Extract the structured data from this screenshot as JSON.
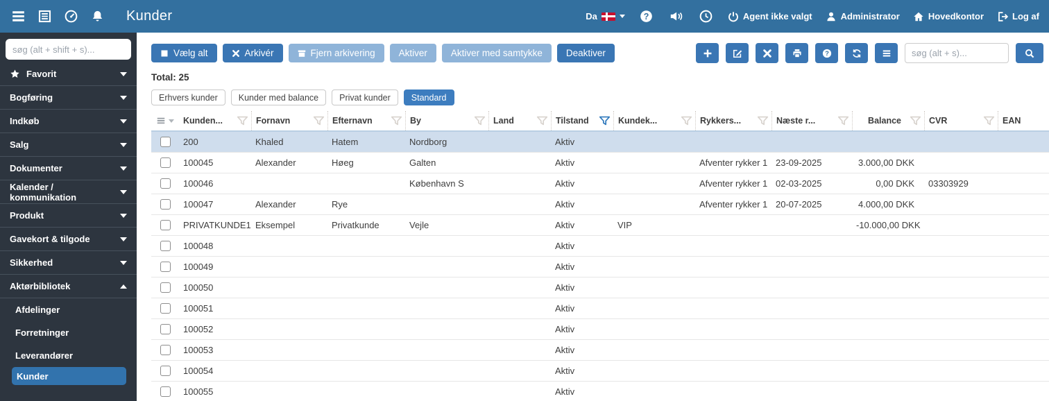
{
  "topbar": {
    "title": "Kunder",
    "left_icons": [
      "menu",
      "journal",
      "dashboard",
      "bell"
    ],
    "language": {
      "code": "Da",
      "flag": "danish-flag"
    },
    "items": [
      {
        "icon": "power",
        "label": "Agent ikke valgt"
      },
      {
        "icon": "user",
        "label": "Administrator"
      },
      {
        "icon": "home",
        "label": "Hovedkontor"
      },
      {
        "icon": "logout",
        "label": "Log af"
      }
    ]
  },
  "sidebar": {
    "search_placeholder": "søg (alt + shift + s)...",
    "items": [
      {
        "label": "Favorit",
        "icon": "star",
        "chevron": "down"
      },
      {
        "label": "Bogføring",
        "chevron": "down"
      },
      {
        "label": "Indkøb",
        "chevron": "down"
      },
      {
        "label": "Salg",
        "chevron": "down"
      },
      {
        "label": "Dokumenter",
        "chevron": "down"
      },
      {
        "label": "Kalender / kommunikation",
        "chevron": "down"
      },
      {
        "label": "Produkt",
        "chevron": "down"
      },
      {
        "label": "Gavekort & tilgode",
        "chevron": "down"
      },
      {
        "label": "Sikkerhed",
        "chevron": "down"
      },
      {
        "label": "Aktørbibliotek",
        "chevron": "up",
        "expanded": true
      }
    ],
    "subitems": [
      {
        "label": "Afdelinger"
      },
      {
        "label": "Forretninger"
      },
      {
        "label": "Leverandører"
      },
      {
        "label": "Kunder",
        "selected": true
      }
    ]
  },
  "toolbar": {
    "buttons": [
      {
        "label": "Vælg alt",
        "icon": "checkbox",
        "variant": "primary"
      },
      {
        "label": "Arkivér",
        "icon": "x",
        "variant": "primary"
      },
      {
        "label": "Fjern arkivering",
        "icon": "archive",
        "variant": "disabled"
      },
      {
        "label": "Aktiver",
        "variant": "disabled"
      },
      {
        "label": "Aktiver med samtykke",
        "variant": "disabled"
      },
      {
        "label": "Deaktiver",
        "variant": "primary"
      }
    ],
    "icon_buttons": [
      "plus",
      "edit",
      "x",
      "print",
      "help",
      "refresh",
      "list"
    ],
    "search_placeholder": "søg (alt + s)..."
  },
  "summary": {
    "total_label": "Total: 25"
  },
  "filters": [
    {
      "label": "Erhvers kunder"
    },
    {
      "label": "Kunder med balance"
    },
    {
      "label": "Privat kunder"
    },
    {
      "label": "Standard",
      "active": true
    }
  ],
  "table": {
    "columns": [
      {
        "key": "kundenummer",
        "label": "Kunden...",
        "filter": true
      },
      {
        "key": "fornavn",
        "label": "Fornavn",
        "filter": true
      },
      {
        "key": "efternavn",
        "label": "Efternavn",
        "filter": true
      },
      {
        "key": "by",
        "label": "By",
        "filter": true
      },
      {
        "key": "land",
        "label": "Land",
        "filter": true
      },
      {
        "key": "tilstand",
        "label": "Tilstand",
        "filter": true,
        "filter_active": true
      },
      {
        "key": "kundekategori",
        "label": "Kundek...",
        "filter": true
      },
      {
        "key": "rykkerstatus",
        "label": "Rykkers...",
        "filter": true
      },
      {
        "key": "naeste_rykker",
        "label": "Næste r...",
        "filter": true
      },
      {
        "key": "balance",
        "label": "Balance",
        "filter": true,
        "align": "right"
      },
      {
        "key": "cvr",
        "label": "CVR",
        "filter": true
      },
      {
        "key": "ean",
        "label": "EAN",
        "filter": false
      }
    ],
    "rows": [
      {
        "selected": true,
        "cells": [
          "200",
          "Khaled",
          "Hatem",
          "Nordborg",
          "",
          "Aktiv",
          "",
          "",
          "",
          "",
          "",
          ""
        ]
      },
      {
        "selected": false,
        "cells": [
          "100045",
          "Alexander",
          "Høeg",
          "Galten",
          "",
          "Aktiv",
          "",
          "Afventer rykker 1",
          "23-09-2025",
          "3.000,00 DKK",
          "",
          ""
        ]
      },
      {
        "selected": false,
        "cells": [
          "100046",
          "",
          "",
          "København S",
          "",
          "Aktiv",
          "",
          "Afventer rykker 1",
          "02-03-2025",
          "0,00 DKK",
          "03303929",
          ""
        ]
      },
      {
        "selected": false,
        "cells": [
          "100047",
          "Alexander",
          "Rye",
          "",
          "",
          "Aktiv",
          "",
          "Afventer rykker 1",
          "20-07-2025",
          "4.000,00 DKK",
          "",
          ""
        ]
      },
      {
        "selected": false,
        "cells": [
          "PRIVATKUNDE1",
          "Eksempel",
          "Privatkunde",
          "Vejle",
          "",
          "Aktiv",
          "VIP",
          "",
          "",
          "-10.000,00 DKK",
          "",
          ""
        ]
      },
      {
        "selected": false,
        "cells": [
          "100048",
          "",
          "",
          "",
          "",
          "Aktiv",
          "",
          "",
          "",
          "",
          "",
          ""
        ]
      },
      {
        "selected": false,
        "cells": [
          "100049",
          "",
          "",
          "",
          "",
          "Aktiv",
          "",
          "",
          "",
          "",
          "",
          ""
        ]
      },
      {
        "selected": false,
        "cells": [
          "100050",
          "",
          "",
          "",
          "",
          "Aktiv",
          "",
          "",
          "",
          "",
          "",
          ""
        ]
      },
      {
        "selected": false,
        "cells": [
          "100051",
          "",
          "",
          "",
          "",
          "Aktiv",
          "",
          "",
          "",
          "",
          "",
          ""
        ]
      },
      {
        "selected": false,
        "cells": [
          "100052",
          "",
          "",
          "",
          "",
          "Aktiv",
          "",
          "",
          "",
          "",
          "",
          ""
        ]
      },
      {
        "selected": false,
        "cells": [
          "100053",
          "",
          "",
          "",
          "",
          "Aktiv",
          "",
          "",
          "",
          "",
          "",
          ""
        ]
      },
      {
        "selected": false,
        "cells": [
          "100054",
          "",
          "",
          "",
          "",
          "Aktiv",
          "",
          "",
          "",
          "",
          "",
          ""
        ]
      },
      {
        "selected": false,
        "cells": [
          "100055",
          "",
          "",
          "",
          "",
          "Aktiv",
          "",
          "",
          "",
          "",
          "",
          ""
        ]
      }
    ]
  },
  "colors": {
    "topbar": "#33709f",
    "sidebar": "#2d353f",
    "primary_button": "#3a76b4",
    "disabled_button": "#8fb4d9",
    "active_chip": "#3d7dbf",
    "selected_nav_item": "#3273ad",
    "selected_row": "#cfdded",
    "active_filter": "#2e78bc"
  }
}
